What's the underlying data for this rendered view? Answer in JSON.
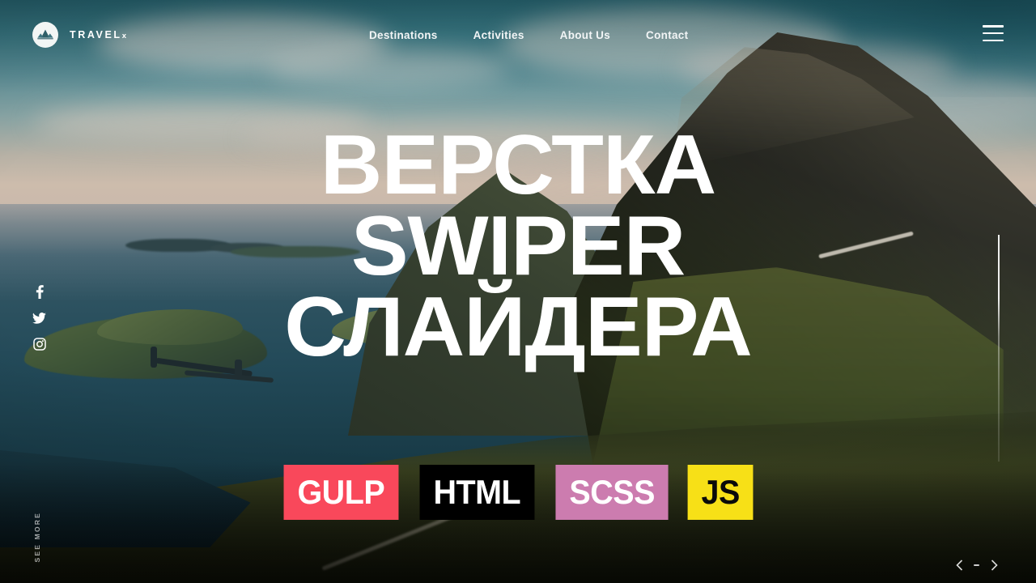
{
  "brand": {
    "name": "TRAVEL",
    "suffix": "x",
    "logo_icon": "mountain-circle-logo-icon"
  },
  "nav": {
    "items": [
      {
        "label": "Destinations"
      },
      {
        "label": "Activities"
      },
      {
        "label": "About Us"
      },
      {
        "label": "Contact"
      }
    ],
    "menu_icon": "hamburger-menu-icon"
  },
  "social": {
    "items": [
      {
        "name": "facebook-icon",
        "label": "Facebook"
      },
      {
        "name": "twitter-icon",
        "label": "Twitter"
      },
      {
        "name": "instagram-icon",
        "label": "Instagram"
      }
    ]
  },
  "hero": {
    "line1": "ВЕРСТКА",
    "line2": "SWIPER",
    "line3": "СЛАЙДЕРА"
  },
  "badges": [
    {
      "label": "GULP",
      "bg": "#F9485B",
      "fg": "#FFFFFF"
    },
    {
      "label": "HTML",
      "bg": "#000000",
      "fg": "#FFFFFF"
    },
    {
      "label": "SCSS",
      "bg": "#CC7CAF",
      "fg": "#FFFFFF"
    },
    {
      "label": "JS",
      "bg": "#F7E017",
      "fg": "#0A0A0A"
    }
  ],
  "see_more": {
    "label": "SEE MORE"
  },
  "slider": {
    "prev_icon": "chevron-left-icon",
    "next_icon": "chevron-right-icon",
    "progress_label": ""
  },
  "colors": {
    "sky_top": "#2b707e",
    "sky_horizon": "#cdbcac",
    "sea_deep": "#0e2a34",
    "foreground_green": "#39401f",
    "text_white": "#FFFFFF"
  }
}
